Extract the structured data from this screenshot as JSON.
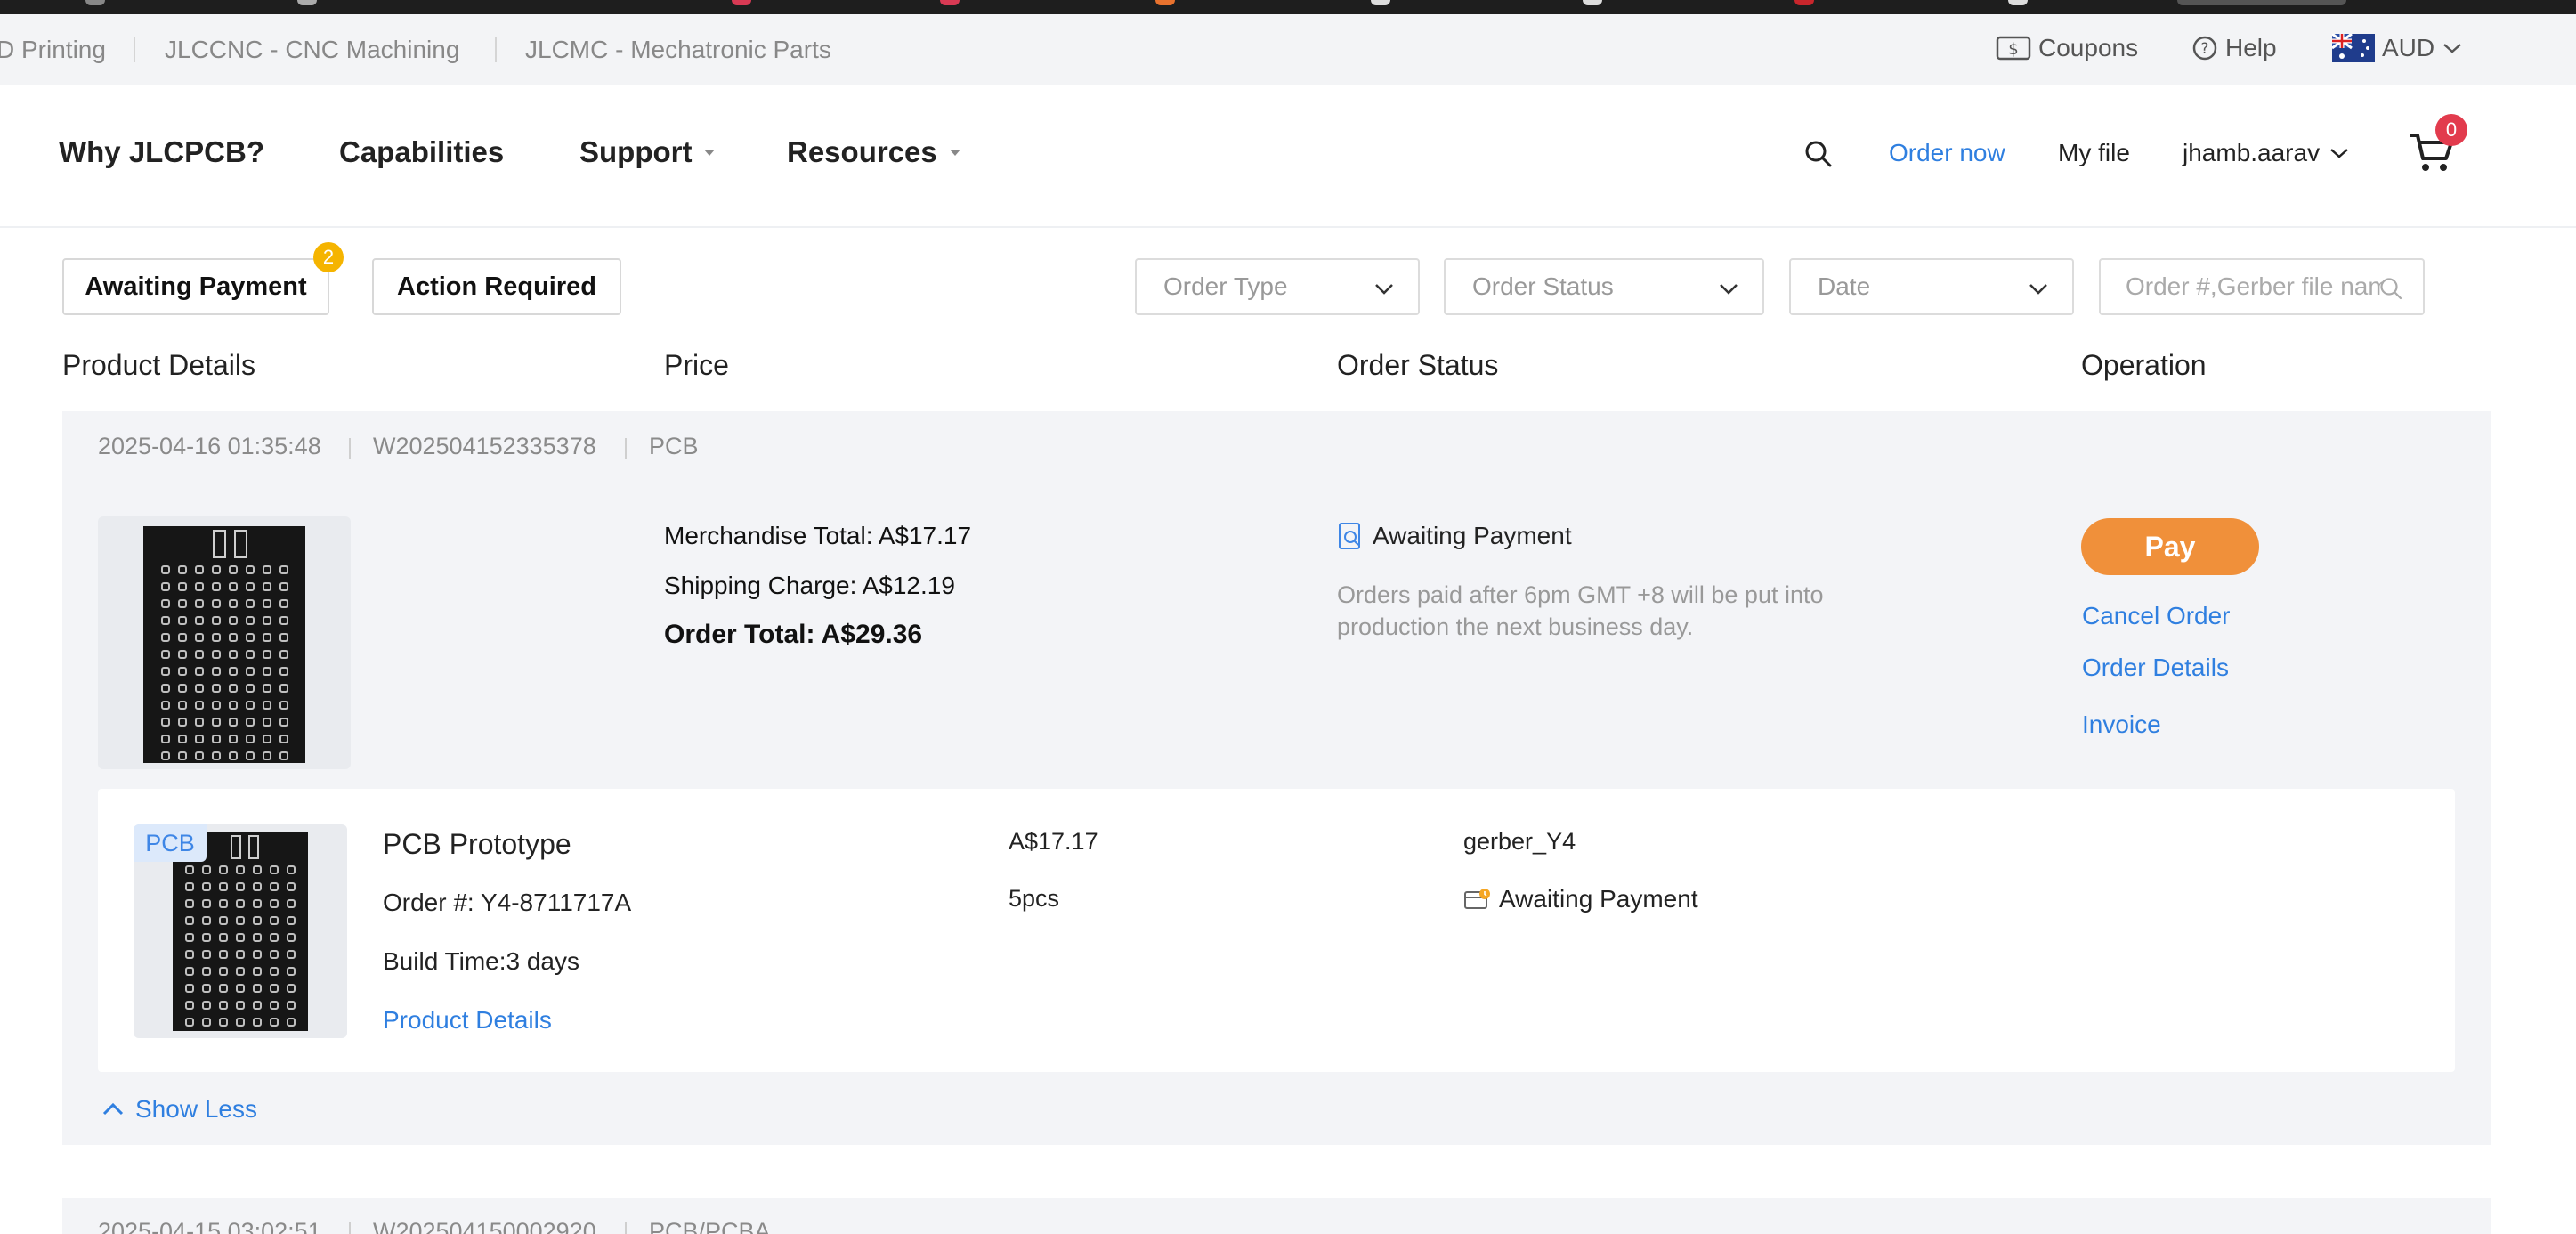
{
  "top_links": [
    "D Printing",
    "JLCCNC - CNC Machining",
    "JLCMC - Mechatronic Parts"
  ],
  "top_utils": {
    "coupons": "Coupons",
    "help": "Help",
    "currency": "AUD"
  },
  "nav": {
    "why": "Why JLCPCB?",
    "capabilities": "Capabilities",
    "support": "Support",
    "resources": "Resources",
    "order_now": "Order now",
    "my_file": "My file",
    "user": "jhamb.aarav",
    "cart_count": "0"
  },
  "filters": {
    "awaiting_payment": "Awaiting Payment",
    "awaiting_payment_count": "2",
    "action_required": "Action Required",
    "order_type": "Order Type",
    "order_status": "Order Status",
    "date": "Date",
    "search_placeholder": "Order #,Gerber file name"
  },
  "columns": [
    "Product Details",
    "Price",
    "Order Status",
    "Operation"
  ],
  "order": {
    "datetime": "2025-04-16 01:35:48",
    "number": "W202504152335378",
    "type": "PCB",
    "merchandise_total": "Merchandise Total: A$17.17",
    "shipping_charge": "Shipping Charge: A$12.19",
    "order_total": "Order Total: A$29.36",
    "status": "Awaiting Payment",
    "status_note": "Orders paid after 6pm GMT +8 will be put into production the next business day.",
    "pay_label": "Pay",
    "cancel_label": "Cancel Order",
    "details_label": "Order Details",
    "invoice_label": "Invoice",
    "item": {
      "tag": "PCB",
      "title": "PCB Prototype",
      "order_no": "Order #: Y4-8711717A",
      "build_time": "Build Time:3 days",
      "details_link": "Product Details",
      "price": "A$17.17",
      "qty": "5pcs",
      "gerber": "gerber_Y4",
      "status": "Awaiting Payment"
    },
    "show_less": "Show Less"
  },
  "next_order": {
    "datetime": "2025-04-15 03:02:51",
    "number": "W202504150002920",
    "type": "PCB/PCBA"
  },
  "colors": {
    "accent_blue": "#2f7fe0",
    "pay_orange": "#f0903a",
    "badge_red": "#e23b4d",
    "badge_yellow": "#f5b400"
  }
}
